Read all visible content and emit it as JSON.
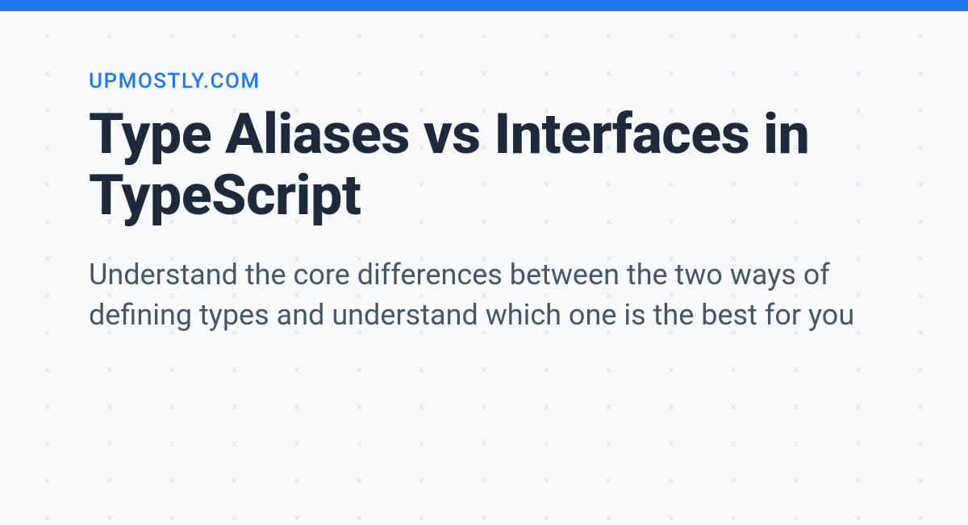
{
  "header": {
    "site_label": "UPMOSTLY.COM"
  },
  "article": {
    "title": "Type Aliases vs Interfaces in TypeScript",
    "description": "Understand the core differences between the two ways of defining types and understand which one is the best for you"
  },
  "colors": {
    "accent": "#2179ee",
    "title": "#1e293b",
    "body": "#475569",
    "pattern": "#cbd5e1",
    "background": "#f9fafb"
  }
}
